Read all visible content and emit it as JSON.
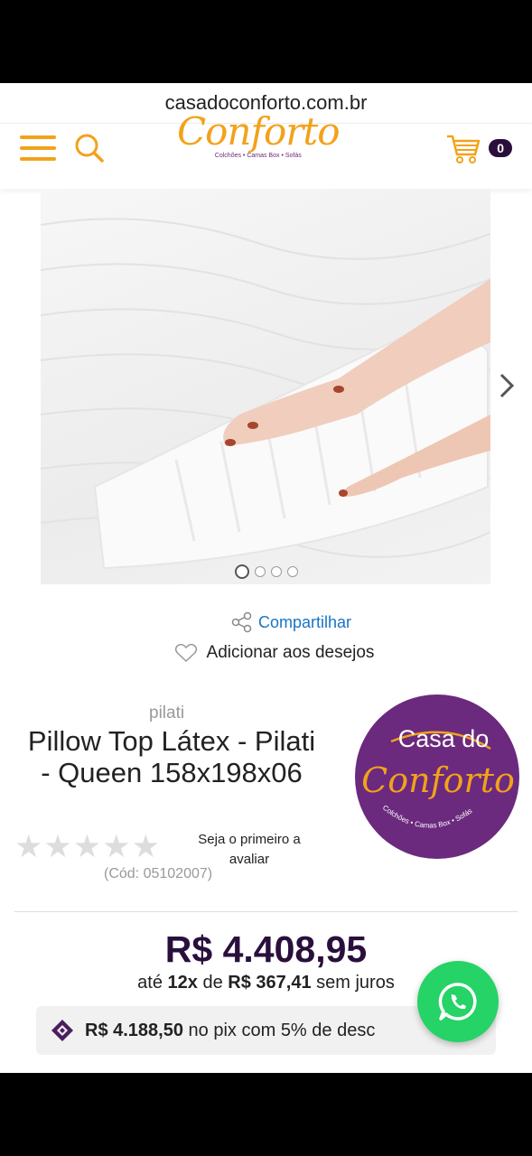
{
  "browser": {
    "url": "casadoconforto.com.br"
  },
  "header": {
    "logo_text": "Conforto",
    "logo_tagline": "Colchões • Camas Box • Sofás",
    "cart_count": "0",
    "accent_color": "#f2a21a",
    "dark_color": "#2a0f3c",
    "icons": [
      "menu-icon",
      "search-icon",
      "cart-icon"
    ]
  },
  "gallery": {
    "image_count": 4,
    "active_index": 0
  },
  "actions": {
    "share_label": "Compartilhar",
    "wishlist_label": "Adicionar aos desejos"
  },
  "product": {
    "brand": "pilati",
    "title": "Pillow Top Látex - Pilati - Queen 158x198x06",
    "rating_stars": 0,
    "rating_max": 5,
    "review_prompt": "Seja o primeiro a avaliar",
    "code": "(Cód: 05102007)"
  },
  "badge": {
    "line1": "Casa do",
    "line2": "Conforto",
    "tagline": "Colchões • Camas Box • Sofás",
    "color": "#6b2a7d"
  },
  "pricing": {
    "price": "R$ 4.408,95",
    "installments_prefix": "até",
    "installments_count": "12x",
    "installments_of": "de",
    "installments_value": "R$ 367,41",
    "installments_suffix": "sem juros",
    "pix_price": "R$ 4.188,50",
    "pix_text": "no pix com 5% de desc"
  }
}
